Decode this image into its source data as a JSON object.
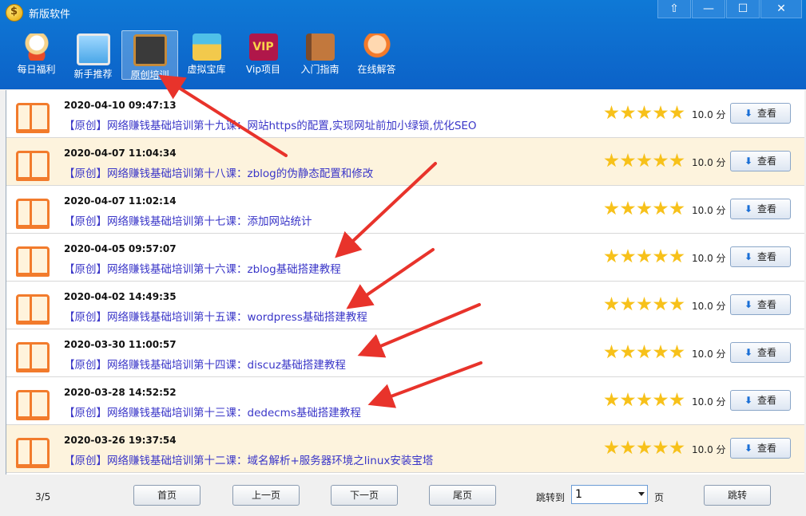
{
  "window": {
    "title": "新版软件",
    "controls": [
      "⇧",
      "—",
      "☐",
      "✕"
    ]
  },
  "toolbar": [
    {
      "label": "每日福利",
      "icon": "lucky-cat-icon"
    },
    {
      "label": "新手推荐",
      "icon": "computer-icon"
    },
    {
      "label": "原创培训",
      "icon": "blackboard-icon",
      "active": true
    },
    {
      "label": "虚拟宝库",
      "icon": "warehouse-icon"
    },
    {
      "label": "Vip项目",
      "icon": "vip-icon",
      "badge": "VIP"
    },
    {
      "label": "入门指南",
      "icon": "books-icon"
    },
    {
      "label": "在线解答",
      "icon": "customer-service-icon"
    }
  ],
  "rows": [
    {
      "date": "2020-04-10 09:47:13",
      "title": "【原创】网络赚钱基础培训第十九课：网站https的配置,实现网址前加小绿锁,优化SEO",
      "score": "10.0 分",
      "button": "查看"
    },
    {
      "date": "2020-04-07 11:04:34",
      "title": "【原创】网络赚钱基础培训第十八课：zblog的伪静态配置和修改",
      "score": "10.0 分",
      "button": "查看"
    },
    {
      "date": "2020-04-07 11:02:14",
      "title": "【原创】网络赚钱基础培训第十七课：添加网站统计",
      "score": "10.0 分",
      "button": "查看"
    },
    {
      "date": "2020-04-05 09:57:07",
      "title": "【原创】网络赚钱基础培训第十六课：zblog基础搭建教程",
      "score": "10.0 分",
      "button": "查看"
    },
    {
      "date": "2020-04-02 14:49:35",
      "title": "【原创】网络赚钱基础培训第十五课：wordpress基础搭建教程",
      "score": "10.0 分",
      "button": "查看"
    },
    {
      "date": "2020-03-30 11:00:57",
      "title": "【原创】网络赚钱基础培训第十四课：discuz基础搭建教程",
      "score": "10.0 分",
      "button": "查看"
    },
    {
      "date": "2020-03-28 14:52:52",
      "title": "【原创】网络赚钱基础培训第十三课：dedecms基础搭建教程",
      "score": "10.0 分",
      "button": "查看"
    },
    {
      "date": "2020-03-26 19:37:54",
      "title": "【原创】网络赚钱基础培训第十二课：域名解析+服务器环境之linux安装宝塔",
      "score": "10.0 分",
      "button": "查看"
    }
  ],
  "rating": {
    "stars": 5,
    "max": 5
  },
  "pager": {
    "info": "3/5",
    "first": "首页",
    "prev": "上一页",
    "next": "下一页",
    "last": "尾页",
    "jump_label": "跳转到",
    "page_value": "1",
    "unit": "页",
    "jump_button": "跳转"
  },
  "colors": {
    "header": "#0c6fd0",
    "title_text": "#3a36c8",
    "alt_row": "#fdf3dd",
    "star": "#f7c11a",
    "arrow": "#e8332b"
  }
}
